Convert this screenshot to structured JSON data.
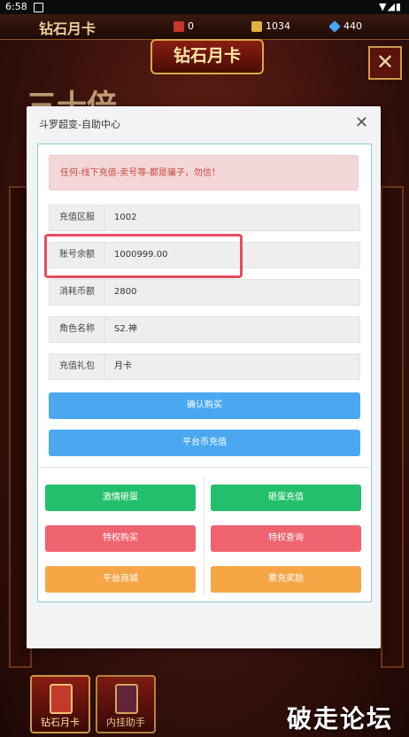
{
  "status_bar": {
    "time": "6:58",
    "icons": "▼◢▮"
  },
  "game": {
    "title": "钻石月卡",
    "banner": "钻石月卡",
    "close_glyph": "✕",
    "big_text": "三十倍",
    "resources": [
      {
        "name": "z-coin",
        "value": "0",
        "color": "#c8342a"
      },
      {
        "name": "gold-ingot",
        "value": "1034",
        "color": "#e2b040"
      },
      {
        "name": "diamond",
        "value": "440",
        "color": "#4aa8f0"
      }
    ],
    "bottom_tabs": [
      {
        "label": "钻石月卡"
      },
      {
        "label": "内挂助手"
      }
    ],
    "watermark": "破走论坛"
  },
  "dialog": {
    "title": "斗罗超变-自助中心",
    "close": "✕",
    "alert": "任何-线下充值-卖号等-都是骗子，勿信！",
    "fields": [
      {
        "label": "充值区服",
        "value": "1002"
      },
      {
        "label": "账号余额",
        "value": "1000999.00"
      },
      {
        "label": "消耗币额",
        "value": "2800"
      },
      {
        "label": "角色名称",
        "value": "S2.神"
      },
      {
        "label": "充值礼包",
        "value": "月卡"
      }
    ],
    "confirm_button": "确认购买",
    "recharge_button": "平台币充值",
    "grid_buttons": [
      {
        "label": "激情砸蛋",
        "color": "green"
      },
      {
        "label": "砸蛋充值",
        "color": "green"
      },
      {
        "label": "特权购买",
        "color": "red"
      },
      {
        "label": "特权查询",
        "color": "red"
      },
      {
        "label": "平台商城",
        "color": "orange"
      },
      {
        "label": "累充奖励",
        "color": "orange"
      }
    ]
  }
}
